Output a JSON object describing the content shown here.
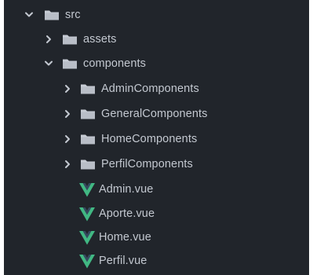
{
  "colors": {
    "background": "#21252b",
    "text": "#c3c8d0",
    "folder_icon": "#c7ccd4",
    "vue_green": "#41b883",
    "vue_dark": "#35495e"
  },
  "tree": {
    "src": {
      "label": "src",
      "icon": "folder-icon",
      "expanded": true
    },
    "assets": {
      "label": "assets",
      "icon": "folder-icon",
      "expanded": false
    },
    "components": {
      "label": "components",
      "icon": "folder-icon",
      "expanded": true
    },
    "admin_components": {
      "label": "AdminComponents",
      "icon": "folder-icon",
      "expanded": false
    },
    "general_components": {
      "label": "GeneralComponents",
      "icon": "folder-icon",
      "expanded": false
    },
    "home_components": {
      "label": "HomeComponents",
      "icon": "folder-icon",
      "expanded": false
    },
    "perfil_components": {
      "label": "PerfilComponents",
      "icon": "folder-icon",
      "expanded": false
    },
    "admin_vue": {
      "label": "Admin.vue",
      "icon": "vue-file-icon"
    },
    "aporte_vue": {
      "label": "Aporte.vue",
      "icon": "vue-file-icon"
    },
    "home_vue": {
      "label": "Home.vue",
      "icon": "vue-file-icon"
    },
    "perfil_vue": {
      "label": "Perfil.vue",
      "icon": "vue-file-icon"
    }
  }
}
